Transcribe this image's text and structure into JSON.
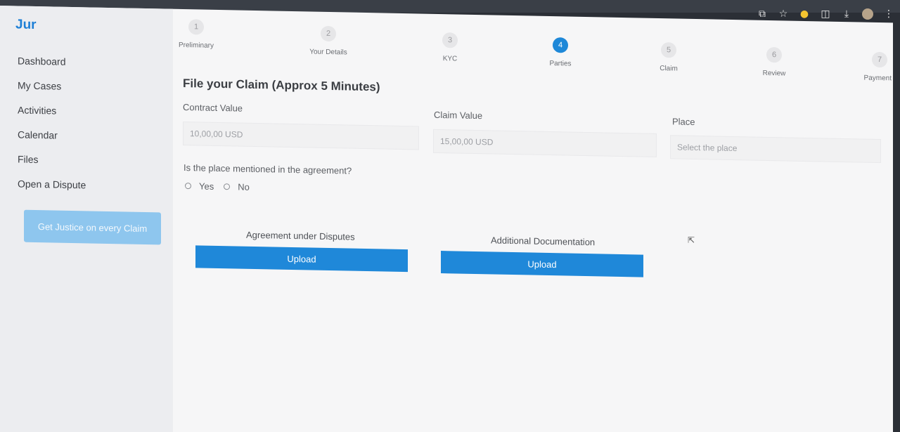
{
  "app": {
    "logo": "Jur"
  },
  "sidebar": {
    "items": [
      {
        "label": "Dashboard"
      },
      {
        "label": "My Cases"
      },
      {
        "label": "Activities"
      },
      {
        "label": "Calendar"
      },
      {
        "label": "Files"
      },
      {
        "label": "Open a Dispute"
      }
    ],
    "cta_label": "Get Justice on every Claim"
  },
  "stepper": {
    "steps": [
      {
        "number": "1",
        "label": "Preliminary"
      },
      {
        "number": "2",
        "label": "Your Details"
      },
      {
        "number": "3",
        "label": "KYC"
      },
      {
        "number": "4",
        "label": "Parties"
      },
      {
        "number": "5",
        "label": "Claim"
      },
      {
        "number": "6",
        "label": "Review"
      },
      {
        "number": "7",
        "label": "Payment"
      }
    ],
    "active_step": "4"
  },
  "form": {
    "title": "File your Claim (Approx 5 Minutes)",
    "contract_value": {
      "label": "Contract Value",
      "placeholder": "10,00,00 USD"
    },
    "claim_value": {
      "label": "Claim Value",
      "placeholder": "15,00,00 USD"
    },
    "place": {
      "label": "Place",
      "placeholder": "Select the place"
    },
    "question": "Is the place mentioned in the agreement?",
    "options": {
      "yes": "Yes",
      "no": "No"
    },
    "upload_agreement": {
      "label": "Agreement under Disputes",
      "button": "Upload"
    },
    "upload_additional": {
      "label": "Additional Documentation",
      "button": "Upload"
    }
  },
  "colors": {
    "accent": "#1f88d9",
    "cta": "#8ec6ee",
    "sidebar_bg": "#ecedf0"
  },
  "browser_icons": [
    "cast-icon",
    "star-icon",
    "extension-icon",
    "puzzle-icon",
    "download-icon",
    "avatar",
    "menu-icon"
  ]
}
